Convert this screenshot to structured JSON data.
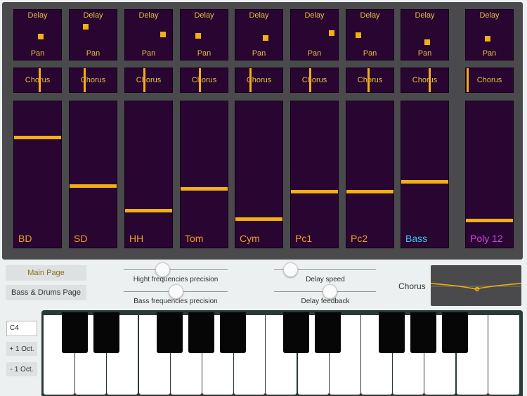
{
  "channels": [
    {
      "name": "BD",
      "name_color": "#f0a020",
      "delay_label": "Delay",
      "pan_label": "Pan",
      "chorus_label": "Chorus",
      "pan": 0.52,
      "delay": 0.52,
      "chorus": 0.54,
      "level": 0.78
    },
    {
      "name": "SD",
      "name_color": "#f0a020",
      "delay_label": "Delay",
      "pan_label": "Pan",
      "chorus_label": "Chorus",
      "pan": 0.26,
      "delay": 0.78,
      "chorus": 0.3,
      "level": 0.43
    },
    {
      "name": "HH",
      "name_color": "#f0a020",
      "delay_label": "Delay",
      "pan_label": "Pan",
      "chorus_label": "Chorus",
      "pan": 0.8,
      "delay": 0.58,
      "chorus": 0.4,
      "level": 0.25
    },
    {
      "name": "Tom",
      "name_color": "#f0a020",
      "delay_label": "Delay",
      "pan_label": "Pan",
      "chorus_label": "Chorus",
      "pan": 0.3,
      "delay": 0.55,
      "chorus": 0.4,
      "level": 0.41
    },
    {
      "name": "Cym",
      "name_color": "#f0a020",
      "delay_label": "Delay",
      "pan_label": "Pan",
      "chorus_label": "Chorus",
      "pan": 0.62,
      "delay": 0.5,
      "chorus": 0.3,
      "level": 0.19
    },
    {
      "name": "Pc1",
      "name_color": "#f0a020",
      "delay_label": "Delay",
      "pan_label": "Pan",
      "chorus_label": "Chorus",
      "pan": 0.88,
      "delay": 0.62,
      "chorus": 0.4,
      "level": 0.39
    },
    {
      "name": "Pc2",
      "name_color": "#f0a020",
      "delay_label": "Delay",
      "pan_label": "Pan",
      "chorus_label": "Chorus",
      "pan": 0.15,
      "delay": 0.56,
      "chorus": 0.46,
      "level": 0.39
    },
    {
      "name": "Bass",
      "name_color": "#3ec8ee",
      "delay_label": "Delay",
      "pan_label": "Pan",
      "chorus_label": "Chorus",
      "pan": 0.5,
      "delay": 0.38,
      "chorus": 0.6,
      "level": 0.46
    },
    {
      "name": "Poly 12",
      "name_color": "#d24ad6",
      "delay_label": "Delay",
      "pan_label": "Pan",
      "chorus_label": "Chorus",
      "pan": 0.4,
      "delay": 0.48,
      "chorus": 0.02,
      "level": 0.18
    }
  ],
  "pages": {
    "main": "Main Page",
    "bass_drums": "Bass & Drums Page"
  },
  "sliders": [
    {
      "id": "high-freq-precision",
      "label": "Hight frequencies precision",
      "value": 0.35
    },
    {
      "id": "bass-freq-precision",
      "label": "Bass frequencies precision",
      "value": 0.5
    },
    {
      "id": "delay-speed",
      "label": "Delay speed",
      "value": 0.1
    },
    {
      "id": "delay-feedback",
      "label": "Delay feedback",
      "value": 0.55
    }
  ],
  "chorus_panel": {
    "label": "Chorus"
  },
  "keyboard": {
    "note": "C4",
    "oct_up": "+ 1 Oct.",
    "oct_down": "- 1 Oct."
  },
  "colors": {
    "panel": "#4a4a4c",
    "cell": "#290532",
    "accent": "#f2b012"
  }
}
